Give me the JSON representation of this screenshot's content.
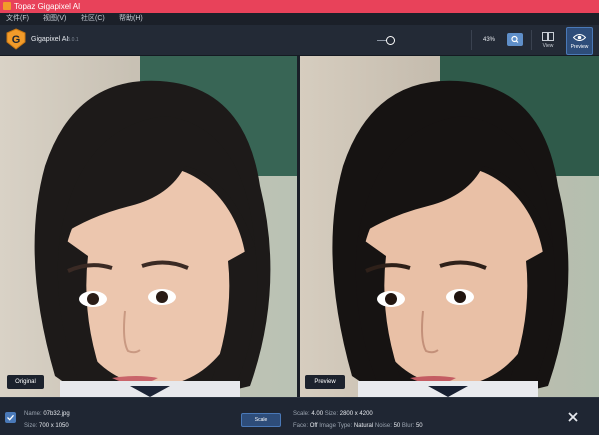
{
  "window": {
    "title": "Topaz Gigapixel AI"
  },
  "menu": [
    "文件(F)",
    "视图(V)",
    "社区(C)",
    "帮助(H)"
  ],
  "toolbar": {
    "app_name": "Gigapixel AI",
    "app_version": "v5.0.1",
    "zoom_value": "43%",
    "view_label": "View",
    "preview_label": "Preview"
  },
  "panes": {
    "left_label": "Original",
    "right_label": "Preview"
  },
  "file": {
    "name_label": "Name:",
    "name": "07b32.jpg",
    "size_label": "Size:",
    "size": "700 x 1050"
  },
  "actions": {
    "scale_button": "Scale"
  },
  "settings": {
    "scale_label": "Scale:",
    "scale": "4.00",
    "out_size_label": "Size:",
    "out_size": "2800 x 4200",
    "face_label": "Face:",
    "face": "Off",
    "image_type_label": "Image Type:",
    "image_type": "Natural",
    "noise_label": "Noise:",
    "noise": "50",
    "blur_label": "Blur:",
    "blur": "50"
  },
  "colors": {
    "accent": "#4a79b8",
    "titlebar": "#e8425a",
    "logo": "#f29b2a"
  }
}
